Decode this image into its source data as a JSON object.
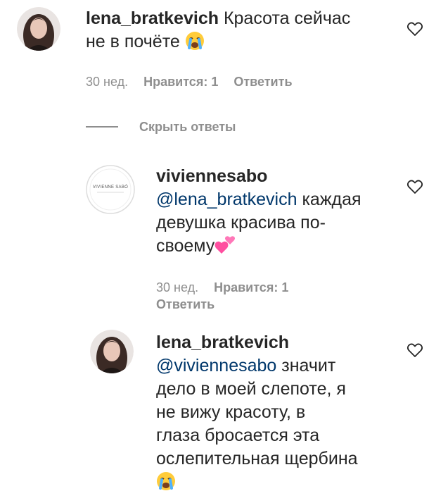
{
  "comments": [
    {
      "username": "lena_bratkevich",
      "text_line1": " Красота сейчас",
      "text_line2": "не в почёте ",
      "emoji": "crying-face",
      "time": "30 нед.",
      "likes": "Нравится: 1",
      "reply": "Ответить"
    }
  ],
  "hide_replies": {
    "label": "Скрыть ответы"
  },
  "replies": [
    {
      "username": "viviennesabo",
      "avatar_text": "VIVIENNE SABÓ",
      "mention": "@lena_bratkevich",
      "text_line1": " каждая",
      "text_line2": "девушка красива по-",
      "text_line3": "своему",
      "emoji": "two-hearts",
      "time": "30 нед.",
      "likes": "Нравится: 1",
      "reply": "Ответить"
    },
    {
      "username": "lena_bratkevich",
      "mention": "@viviennesabo",
      "text_line1": " значит",
      "text_line2": "дело в моей слепоте, я",
      "text_line3": "не вижу красоту, в",
      "text_line4": "глаза бросается эта",
      "text_line5": "ослепительная щербина",
      "emoji": "crying-face"
    }
  ],
  "icons": {
    "like": "heart-outline-icon"
  },
  "colors": {
    "text": "#262626",
    "secondary": "#8e8e8e",
    "mention": "#00376b"
  }
}
